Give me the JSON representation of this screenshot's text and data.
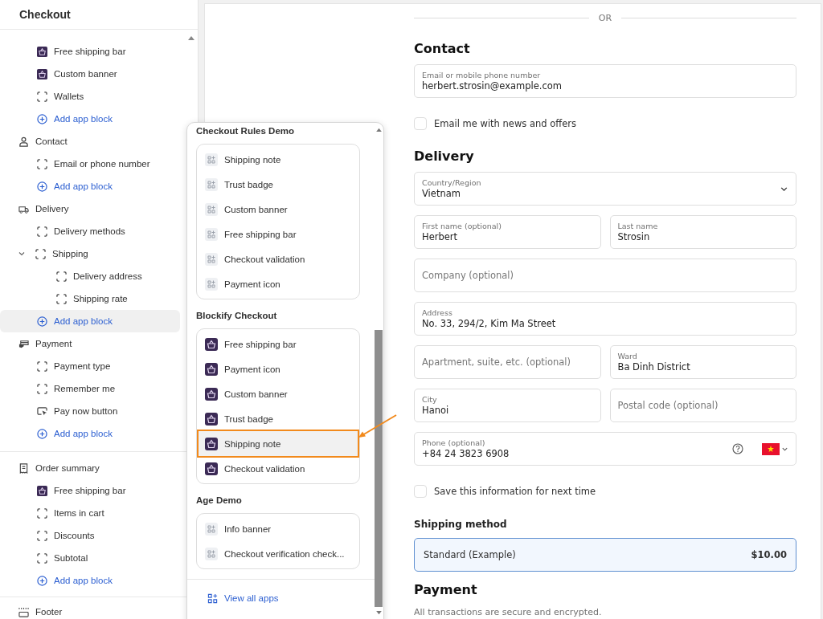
{
  "sidebar": {
    "title": "Checkout",
    "groups": [
      {
        "sections": [
          {
            "items": [
              {
                "label": "Free shipping bar",
                "kind": "app",
                "selected": false
              },
              {
                "label": "Custom banner",
                "kind": "app",
                "selected": false
              },
              {
                "label": "Wallets",
                "kind": "block",
                "selected": false
              },
              {
                "label": "Add app block",
                "kind": "add",
                "selected": false
              }
            ]
          },
          {
            "title": "Contact",
            "items": [
              {
                "label": "Email or phone number",
                "kind": "block",
                "selected": false
              },
              {
                "label": "Add app block",
                "kind": "add",
                "selected": false
              }
            ]
          },
          {
            "title": "Delivery",
            "items": [
              {
                "label": "Delivery methods",
                "kind": "block",
                "selected": false
              },
              {
                "label": "Shipping",
                "kind": "block",
                "selected": false,
                "expanded": true,
                "children": [
                  {
                    "label": "Delivery address",
                    "kind": "block",
                    "selected": false
                  },
                  {
                    "label": "Shipping rate",
                    "kind": "block",
                    "selected": false
                  }
                ]
              },
              {
                "label": "Add app block",
                "kind": "add",
                "selected": true
              }
            ]
          },
          {
            "title": "Payment",
            "items": [
              {
                "label": "Payment type",
                "kind": "block",
                "selected": false
              },
              {
                "label": "Remember me",
                "kind": "block",
                "selected": false
              },
              {
                "label": "Pay now button",
                "kind": "cursor",
                "selected": false
              },
              {
                "label": "Add app block",
                "kind": "add",
                "selected": false
              }
            ]
          }
        ]
      },
      {
        "sections": [
          {
            "title": "Order summary",
            "items": [
              {
                "label": "Free shipping bar",
                "kind": "app",
                "selected": false
              },
              {
                "label": "Items in cart",
                "kind": "block",
                "selected": false
              },
              {
                "label": "Discounts",
                "kind": "block",
                "selected": false
              },
              {
                "label": "Subtotal",
                "kind": "block",
                "selected": false
              },
              {
                "label": "Add app block",
                "kind": "add",
                "selected": false
              }
            ]
          }
        ]
      },
      {
        "sections": [
          {
            "title": "Footer"
          }
        ]
      }
    ]
  },
  "popover": {
    "groups": [
      {
        "title": "Checkout Rules Demo",
        "items": [
          {
            "label": "Shipping note",
            "kind": "generic",
            "highlighted": false
          },
          {
            "label": "Trust badge",
            "kind": "generic",
            "highlighted": false
          },
          {
            "label": "Custom banner",
            "kind": "generic",
            "highlighted": false
          },
          {
            "label": "Free shipping bar",
            "kind": "generic",
            "highlighted": false
          },
          {
            "label": "Checkout validation",
            "kind": "generic",
            "highlighted": false
          },
          {
            "label": "Payment icon",
            "kind": "generic",
            "highlighted": false
          }
        ]
      },
      {
        "title": "Blockify Checkout",
        "items": [
          {
            "label": "Free shipping bar",
            "kind": "app",
            "highlighted": false
          },
          {
            "label": "Payment icon",
            "kind": "app",
            "highlighted": false
          },
          {
            "label": "Custom banner",
            "kind": "app",
            "highlighted": false
          },
          {
            "label": "Trust badge",
            "kind": "app",
            "highlighted": false
          },
          {
            "label": "Shipping note",
            "kind": "app",
            "highlighted": true
          },
          {
            "label": "Checkout validation",
            "kind": "app",
            "highlighted": false
          }
        ]
      },
      {
        "title": "Age Demo",
        "items": [
          {
            "label": "Info banner",
            "kind": "generic",
            "highlighted": false
          },
          {
            "label": "Checkout verification check...",
            "kind": "generic",
            "highlighted": false
          }
        ]
      }
    ],
    "footer_link": "View all apps"
  },
  "form": [
    {
      "kind": "separator",
      "text": "OR"
    },
    {
      "kind": "heading",
      "text": "Contact"
    },
    {
      "kind": "fields",
      "fields": [
        {
          "kind": "text",
          "label": "Email or mobile phone number",
          "value": "herbert.strosin@example.com"
        }
      ]
    },
    {
      "kind": "checkbox",
      "text": "Email me with news and offers",
      "checked": false
    },
    {
      "kind": "heading",
      "text": "Delivery"
    },
    {
      "kind": "fields",
      "fields": [
        {
          "kind": "select",
          "label": "Country/Region",
          "value": "Vietnam"
        }
      ]
    },
    {
      "kind": "fields",
      "fields": [
        {
          "kind": "text",
          "label": "First name (optional)",
          "value": "Herbert"
        },
        {
          "kind": "text",
          "label": "Last name",
          "value": "Strosin"
        }
      ]
    },
    {
      "kind": "fields",
      "fields": [
        {
          "kind": "text",
          "placeholder": "Company (optional)"
        }
      ]
    },
    {
      "kind": "fields",
      "fields": [
        {
          "kind": "text",
          "label": "Address",
          "value": "No. 33, 294/2, Kim Ma Street"
        }
      ]
    },
    {
      "kind": "fields",
      "fields": [
        {
          "kind": "text",
          "placeholder": "Apartment, suite, etc. (optional)"
        },
        {
          "kind": "text",
          "label": "Ward",
          "value": "Ba Dinh District"
        }
      ]
    },
    {
      "kind": "fields",
      "fields": [
        {
          "kind": "text",
          "label": "City",
          "value": "Hanoi"
        },
        {
          "kind": "text",
          "placeholder": "Postal code (optional)"
        }
      ]
    },
    {
      "kind": "fields",
      "fields": [
        {
          "kind": "phone",
          "label": "Phone (optional)",
          "value": "+84 24 3823 6908"
        }
      ]
    },
    {
      "kind": "checkbox",
      "text": "Save this information for next time",
      "checked": false
    },
    {
      "kind": "subheading",
      "text": "Shipping method"
    },
    {
      "kind": "option",
      "label": "Standard (Example)",
      "price": "$10.00",
      "selected": true
    },
    {
      "kind": "heading",
      "text": "Payment"
    },
    {
      "kind": "note",
      "text": "All transactions are secure and encrypted."
    }
  ]
}
